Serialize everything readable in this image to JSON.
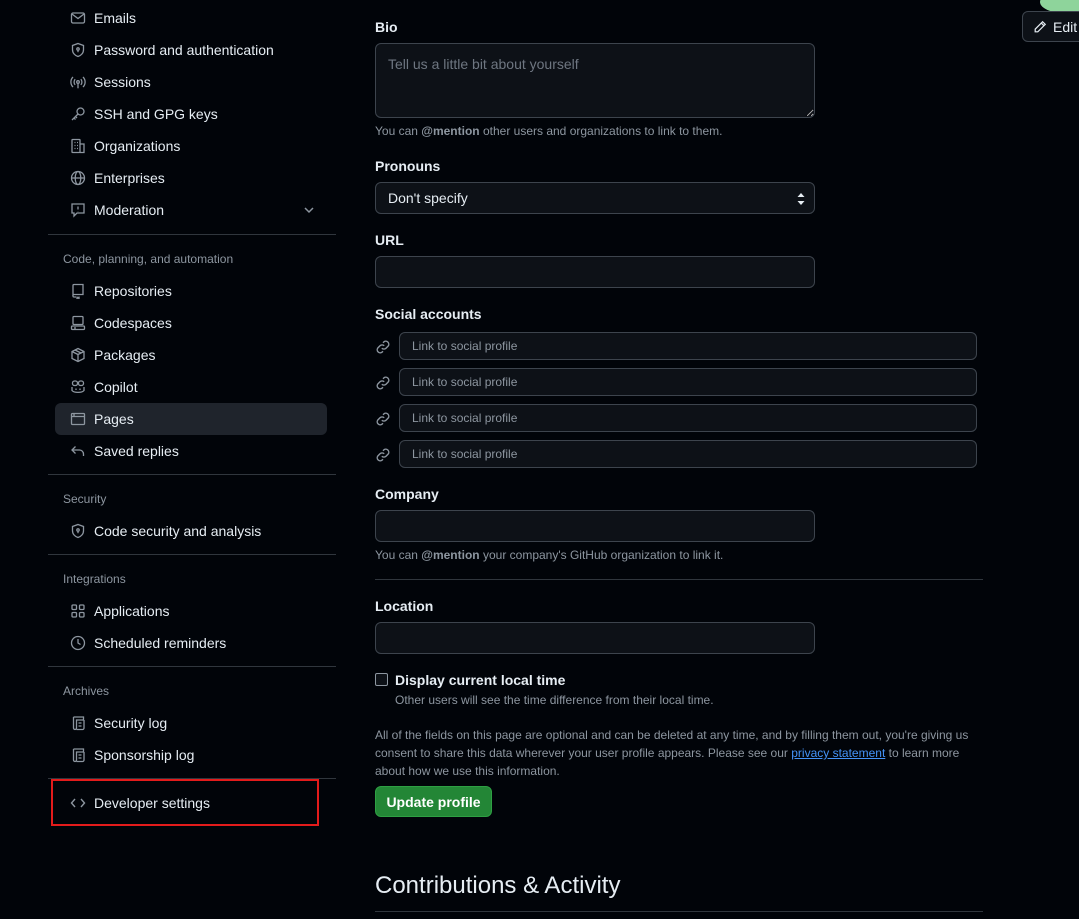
{
  "sidebar": {
    "account_items": [
      {
        "label": "Emails",
        "icon": "mail-icon"
      },
      {
        "label": "Password and authentication",
        "icon": "shield-lock-icon"
      },
      {
        "label": "Sessions",
        "icon": "broadcast-icon"
      },
      {
        "label": "SSH and GPG keys",
        "icon": "key-icon"
      },
      {
        "label": "Organizations",
        "icon": "organization-icon"
      },
      {
        "label": "Enterprises",
        "icon": "globe-icon"
      },
      {
        "label": "Moderation",
        "icon": "report-icon"
      }
    ],
    "code_section_title": "Code, planning, and automation",
    "code_items": [
      {
        "label": "Repositories",
        "icon": "repo-icon"
      },
      {
        "label": "Codespaces",
        "icon": "codespaces-icon"
      },
      {
        "label": "Packages",
        "icon": "package-icon"
      },
      {
        "label": "Copilot",
        "icon": "copilot-icon"
      },
      {
        "label": "Pages",
        "icon": "browser-icon"
      },
      {
        "label": "Saved replies",
        "icon": "reply-icon"
      }
    ],
    "security_section_title": "Security",
    "security_items": [
      {
        "label": "Code security and analysis",
        "icon": "shield-lock-icon"
      }
    ],
    "integrations_section_title": "Integrations",
    "integrations_items": [
      {
        "label": "Applications",
        "icon": "apps-icon"
      },
      {
        "label": "Scheduled reminders",
        "icon": "clock-icon"
      }
    ],
    "archives_section_title": "Archives",
    "archives_items": [
      {
        "label": "Security log",
        "icon": "log-icon"
      },
      {
        "label": "Sponsorship log",
        "icon": "log-icon"
      }
    ],
    "developer_settings": {
      "label": "Developer settings",
      "icon": "code-icon"
    }
  },
  "form": {
    "bio": {
      "label": "Bio",
      "placeholder": "Tell us a little bit about yourself",
      "note_pre": "You can ",
      "note_mention": "@mention",
      "note_post": " other users and organizations to link to them."
    },
    "pronouns": {
      "label": "Pronouns",
      "value": "Don't specify"
    },
    "url": {
      "label": "URL",
      "value": ""
    },
    "social": {
      "label": "Social accounts",
      "placeholder": "Link to social profile"
    },
    "company": {
      "label": "Company",
      "value": "",
      "note_pre": "You can ",
      "note_mention": "@mention",
      "note_post": " your company's GitHub organization to link it."
    },
    "location": {
      "label": "Location",
      "value": ""
    },
    "local_time": {
      "label": "Display current local time",
      "note": "Other users will see the time difference from their local time.",
      "checked": false
    },
    "disclaimer_line1": "All of the fields on this page are optional and can be deleted at any time, and by filling them out, you're giving us",
    "disclaimer_line2_pre": "consent to share this data wherever your user profile appears. Please see our ",
    "privacy_link": "privacy statement",
    "disclaimer_line2_post": " to learn more",
    "disclaimer_line3": "about how we use this information.",
    "submit_label": "Update profile"
  },
  "contributions_heading": "Contributions & Activity",
  "edit_label": "Edit",
  "colors": {
    "accent_green": "#238636",
    "highlight_red": "#e31b1b",
    "link_blue": "#4493f8"
  }
}
